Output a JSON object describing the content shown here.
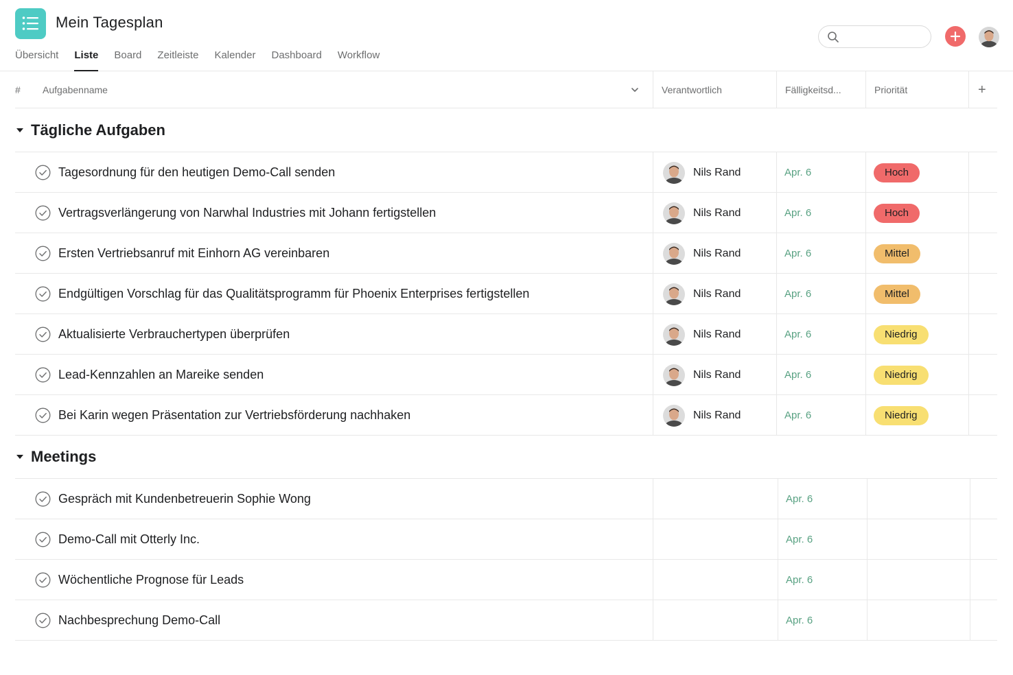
{
  "project": {
    "title": "Mein Tagesplan",
    "icon": "list-icon",
    "accent": "#4ecbc4"
  },
  "tabs": [
    {
      "label": "Übersicht",
      "active": false
    },
    {
      "label": "Liste",
      "active": true
    },
    {
      "label": "Board",
      "active": false
    },
    {
      "label": "Zeitleiste",
      "active": false
    },
    {
      "label": "Kalender",
      "active": false
    },
    {
      "label": "Dashboard",
      "active": false
    },
    {
      "label": "Workflow",
      "active": false
    }
  ],
  "search": {
    "placeholder": "",
    "value": ""
  },
  "columns": {
    "number": "#",
    "task_name": "Aufgabenname",
    "assignee": "Verantwortlich",
    "due": "Fälligkeitsd...",
    "priority": "Priorität",
    "add": "+"
  },
  "sections": [
    {
      "title": "Tägliche Aufgaben",
      "tasks": [
        {
          "name": "Tagesordnung für den heutigen Demo-Call senden",
          "assignee": "Nils Rand",
          "due": "Apr. 6",
          "priority": "Hoch",
          "priority_level": "high"
        },
        {
          "name": "Vertragsverlängerung von Narwhal Industries mit Johann fertigstellen",
          "assignee": "Nils Rand",
          "due": "Apr. 6",
          "priority": "Hoch",
          "priority_level": "high"
        },
        {
          "name": "Ersten Vertriebsanruf mit Einhorn AG vereinbaren",
          "assignee": "Nils Rand",
          "due": "Apr. 6",
          "priority": "Mittel",
          "priority_level": "med"
        },
        {
          "name": "Endgültigen Vorschlag für das Qualitätsprogramm für Phoenix Enterprises fertigstellen",
          "assignee": "Nils Rand",
          "due": "Apr. 6",
          "priority": "Mittel",
          "priority_level": "med"
        },
        {
          "name": "Aktualisierte Verbrauchertypen überprüfen",
          "assignee": "Nils Rand",
          "due": "Apr. 6",
          "priority": "Niedrig",
          "priority_level": "low"
        },
        {
          "name": "Lead-Kennzahlen an Mareike senden",
          "assignee": "Nils Rand",
          "due": "Apr. 6",
          "priority": "Niedrig",
          "priority_level": "low"
        },
        {
          "name": "Bei Karin wegen Präsentation zur Vertriebsförderung nachhaken",
          "assignee": "Nils Rand",
          "due": "Apr. 6",
          "priority": "Niedrig",
          "priority_level": "low"
        }
      ]
    },
    {
      "title": "Meetings",
      "tasks": [
        {
          "name": "Gespräch mit Kundenbetreuerin Sophie Wong",
          "assignee": "",
          "due": "Apr. 6",
          "priority": "",
          "priority_level": ""
        },
        {
          "name": "Demo-Call mit Otterly Inc.",
          "assignee": "",
          "due": "Apr. 6",
          "priority": "",
          "priority_level": ""
        },
        {
          "name": "Wöchentliche Prognose für Leads",
          "assignee": "",
          "due": "Apr. 6",
          "priority": "",
          "priority_level": ""
        },
        {
          "name": "Nachbesprechung Demo-Call",
          "assignee": "",
          "due": "Apr. 6",
          "priority": "",
          "priority_level": ""
        }
      ]
    }
  ],
  "colors": {
    "priority_high": "#f06a6a",
    "priority_medium": "#f1bd6c",
    "priority_low": "#f8df72",
    "due_date": "#58a182",
    "add_button": "#f06a6a"
  }
}
